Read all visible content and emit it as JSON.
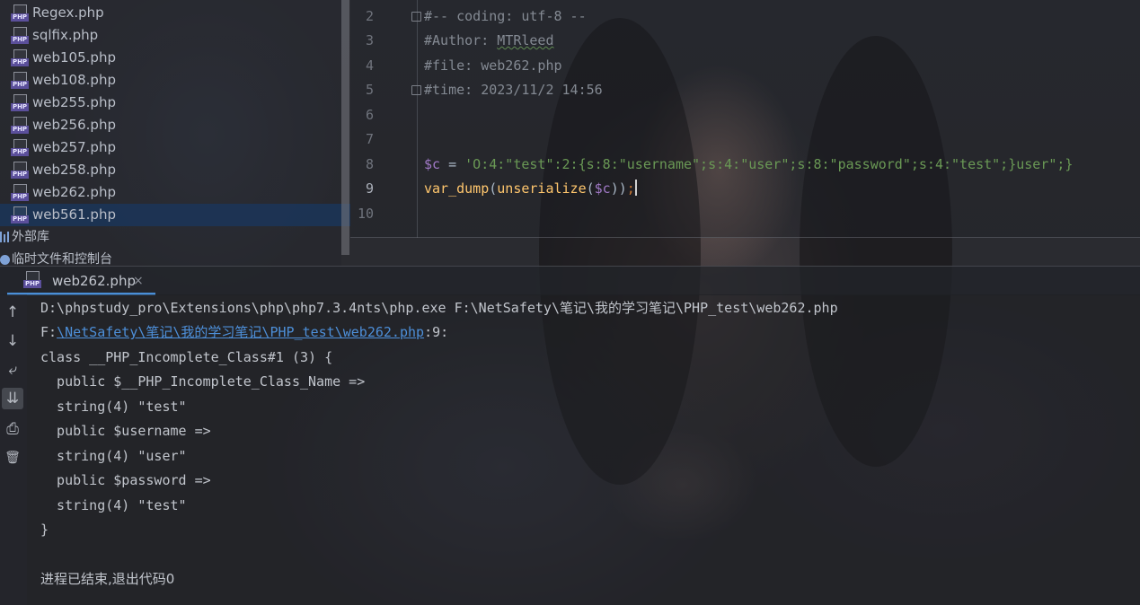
{
  "project_tree": {
    "files": [
      {
        "name": "Regex.php",
        "selected": false
      },
      {
        "name": "sqlfix.php",
        "selected": false
      },
      {
        "name": "web105.php",
        "selected": false
      },
      {
        "name": "web108.php",
        "selected": false
      },
      {
        "name": "web255.php",
        "selected": false
      },
      {
        "name": "web256.php",
        "selected": false
      },
      {
        "name": "web257.php",
        "selected": false
      },
      {
        "name": "web258.php",
        "selected": false
      },
      {
        "name": "web262.php",
        "selected": false
      },
      {
        "name": "web561.php",
        "selected": true
      }
    ],
    "file_icon_text": "PHP",
    "external_libraries": "外部库",
    "scratches": "临时文件和控制台"
  },
  "editor": {
    "line_numbers": [
      "2",
      "3",
      "4",
      "5",
      "6",
      "7",
      "8",
      "9",
      "10"
    ],
    "current_line": "9",
    "lines": {
      "l2": "#-- coding: utf-8 --",
      "l3_prefix": "#Author: ",
      "l3_name": "MTRleed",
      "l4": "#file: web262.php",
      "l5": "#time: 2023/11/2 14:56",
      "l8_var": "$c",
      "l8_op": " = ",
      "l8_str": "'O:4:\"test\":2:{s:8:\"username\";s:4:\"user\";s:8:\"password\";s:4:\"test\";}user\";}",
      "l9_fn1": "var_dump",
      "l9_p1": "(",
      "l9_fn2": "unserialize",
      "l9_p2": "(",
      "l9_var": "$c",
      "l9_p3": "))",
      "l9_semi": ";"
    }
  },
  "run_panel": {
    "tab_label": "web262.php",
    "tab_close": "×",
    "toolbar_icons": [
      "arrow-up-icon",
      "arrow-down-icon",
      "soft-wrap-icon",
      "scroll-to-end-icon",
      "print-icon",
      "trash-icon"
    ],
    "toolbar_glyphs": [
      "↑",
      "↓",
      "⤶",
      "⇊",
      "⎙",
      "🗑"
    ],
    "output": {
      "cmd": "D:\\phpstudy_pro\\Extensions\\php\\php7.3.4nts\\php.exe F:\\NetSafety\\笔记\\我的学习笔记\\PHP_test\\web262.php",
      "loc_prefix": "F:",
      "loc_link": "\\NetSafety\\笔记\\我的学习笔记\\PHP_test\\web262.php",
      "loc_suffix": ":9:",
      "o1": "class __PHP_Incomplete_Class#1 (3) {",
      "o2": "  public $__PHP_Incomplete_Class_Name =>",
      "o3": "  string(4) \"test\"",
      "o4": "  public $username =>",
      "o5": "  string(4) \"user\"",
      "o6": "  public $password =>",
      "o7": "  string(4) \"test\"",
      "o8": "}",
      "exit": "进程已结束,退出代码0"
    }
  },
  "colors": {
    "selection": "#19375f",
    "link": "#4d8fd9",
    "tab_underline": "#4a8fd8",
    "variable": "#a079c6",
    "string": "#6a9955",
    "function": "#ffc66d"
  }
}
